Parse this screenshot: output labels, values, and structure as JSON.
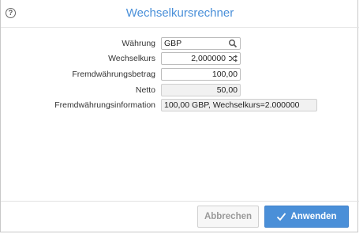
{
  "dialog": {
    "title": "Wechselkursrechner",
    "help_glyph": "?"
  },
  "form": {
    "currency": {
      "label": "Währung",
      "value": "GBP"
    },
    "rate": {
      "label": "Wechselkurs",
      "value": "2,000000"
    },
    "foreign_amount": {
      "label": "Fremdwährungsbetrag",
      "value": "100,00"
    },
    "net": {
      "label": "Netto",
      "value": "50,00"
    },
    "info": {
      "label": "Fremdwährungsinformation",
      "value": "100,00 GBP, Wechselkurs=2.000000"
    }
  },
  "buttons": {
    "cancel": "Abbrechen",
    "apply": "Anwenden"
  },
  "icons": {
    "help": "help-circle-icon",
    "search": "search-icon",
    "swap": "shuffle-icon",
    "check": "check-icon"
  },
  "colors": {
    "accent": "#4a90d9",
    "primary_button": "#4a8fd8"
  }
}
